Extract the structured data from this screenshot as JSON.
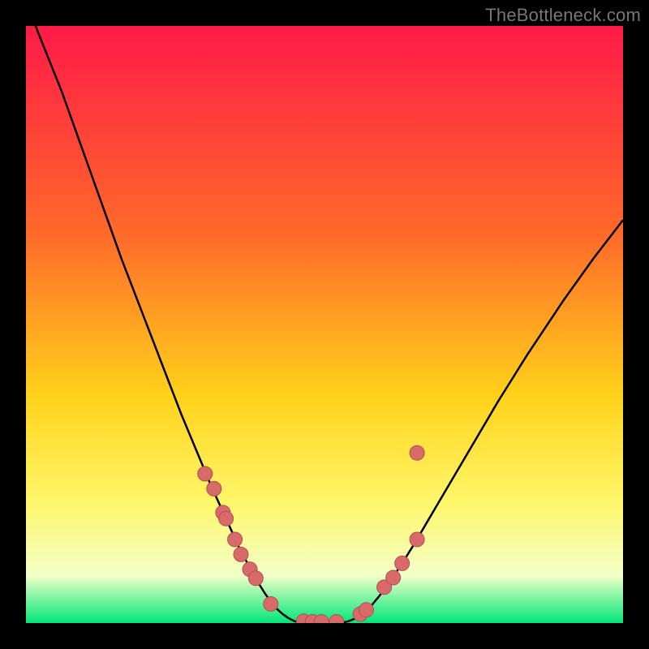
{
  "attribution": "TheBottleneck.com",
  "colors": {
    "curve": "#000000",
    "marker_fill": "#d86a6a",
    "marker_stroke": "#b24f4f",
    "gradient_top": "#ff1a48",
    "gradient_mid1": "#ff6a2a",
    "gradient_mid2": "#ffd21a",
    "gradient_mid3": "#fff76b",
    "gradient_mid4": "#f2ffc8",
    "gradient_bottom": "#00e77a"
  },
  "chart_data": {
    "type": "line",
    "title": "",
    "xlabel": "",
    "ylabel": "",
    "xlim": [
      0,
      100
    ],
    "ylim": [
      0,
      100
    ],
    "curve": {
      "x": [
        0,
        1,
        2,
        3,
        4,
        5,
        6,
        7,
        8,
        9,
        10,
        11,
        12,
        13,
        14,
        15,
        16,
        17,
        18,
        19,
        20,
        21,
        22,
        23,
        24,
        25,
        26,
        27,
        28,
        29,
        30,
        31,
        32,
        33,
        34,
        35,
        36,
        37,
        38,
        39,
        40,
        41,
        42,
        43,
        44,
        45,
        46,
        47,
        48,
        49,
        50,
        51,
        52,
        53,
        54,
        55,
        56,
        57,
        58,
        59,
        60,
        61,
        62,
        63,
        64,
        65,
        66,
        67,
        68,
        69,
        70,
        71,
        72,
        73,
        74,
        75,
        76,
        77,
        78,
        79,
        80,
        81,
        82,
        83,
        84,
        85,
        86,
        87,
        88,
        89,
        90,
        91,
        92,
        93,
        94,
        95,
        96,
        97,
        98,
        99,
        100
      ],
      "y": [
        104,
        101.5,
        99,
        96.5,
        94,
        91.5,
        89,
        86.2,
        83.4,
        80.6,
        77.8,
        75,
        72.2,
        69.4,
        66.6,
        63.8,
        61,
        58.4,
        55.8,
        53.2,
        50.6,
        48,
        45.4,
        42.8,
        40.2,
        37.6,
        35,
        32.6,
        30.2,
        27.8,
        25.4,
        23,
        20.8,
        18.6,
        16.4,
        14.2,
        12,
        10.2,
        8.4,
        6.6,
        5,
        3.6,
        2.4,
        1.5,
        0.8,
        0.3,
        0.08,
        0,
        0,
        0,
        0,
        0,
        0,
        0.08,
        0.3,
        0.7,
        1.3,
        2.1,
        3.1,
        4.3,
        5.6,
        7,
        8.5,
        10,
        11.6,
        13.2,
        14.9,
        16.6,
        18.3,
        20,
        21.7,
        23.4,
        25.1,
        26.8,
        28.5,
        30.2,
        31.9,
        33.6,
        35.3,
        37,
        38.6,
        40.2,
        41.8,
        43.4,
        45,
        46.5,
        48,
        49.5,
        51,
        52.5,
        54,
        55.4,
        56.8,
        58.2,
        59.6,
        61,
        62.3,
        63.6,
        64.9,
        66.2,
        67.5
      ]
    },
    "markers": {
      "x": [
        30,
        31.5,
        33,
        33.5,
        35,
        36,
        37.5,
        38.5,
        41,
        46.5,
        48,
        49.5,
        52,
        56,
        57,
        60,
        61.5,
        63,
        65.5,
        65.5
      ],
      "y": [
        25,
        22.5,
        18.5,
        17.5,
        14,
        11.5,
        9,
        7.5,
        3.2,
        0.3,
        0.2,
        0.2,
        0.2,
        1.5,
        2.2,
        6,
        7.6,
        10,
        14,
        28.5
      ]
    }
  }
}
